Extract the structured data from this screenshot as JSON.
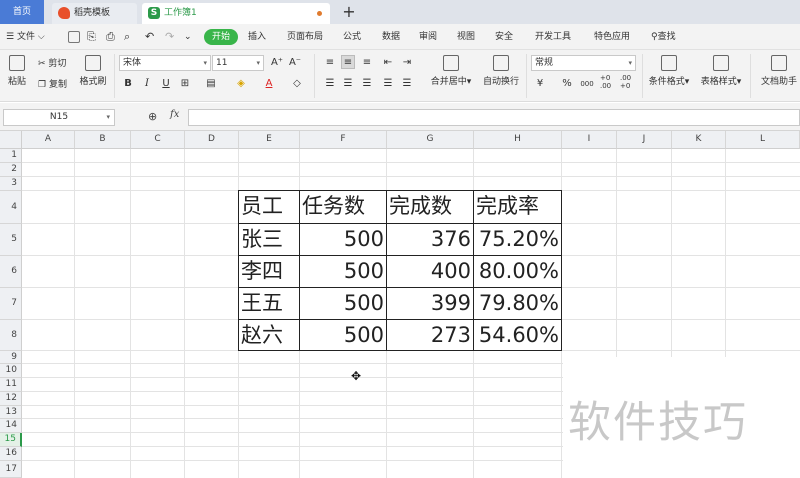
{
  "tabs": {
    "home": "首页",
    "daoke": "稻壳模板",
    "workbook": "工作簿1",
    "add": "+"
  },
  "menu": {
    "file": "文件",
    "items": [
      "开始",
      "插入",
      "页面布局",
      "公式",
      "数据",
      "审阅",
      "视图",
      "安全",
      "开发工具",
      "特色应用"
    ],
    "search": "查找"
  },
  "ribbon": {
    "paste": "粘贴",
    "cut": "剪切",
    "copy": "复制",
    "format_painter": "格式刷",
    "font_name": "宋体",
    "font_size": "11",
    "bold": "B",
    "italic": "I",
    "underline": "U",
    "merge_center": "合并居中",
    "wrap_text": "自动换行",
    "number_format": "常规",
    "percent": "%",
    "thousands": "000",
    "inc_decimal": "+0 .00",
    "dec_decimal": ".00 +0",
    "conditional_format": "条件格式",
    "table_style": "表格样式",
    "doc_helper": "文档助手"
  },
  "formula_bar": {
    "name_box": "N15",
    "fx": "fx",
    "formula": ""
  },
  "columns": [
    "A",
    "B",
    "C",
    "D",
    "E",
    "F",
    "G",
    "H",
    "I",
    "J",
    "K",
    "L"
  ],
  "rows": [
    "1",
    "2",
    "3",
    "4",
    "5",
    "6",
    "7",
    "8",
    "9",
    "10",
    "11",
    "12",
    "13",
    "14",
    "15",
    "16",
    "17"
  ],
  "selected_row": "15",
  "table": {
    "headers": [
      "员工",
      "任务数",
      "完成数",
      "完成率"
    ],
    "rows": [
      [
        "张三",
        "500",
        "376",
        "75.20%"
      ],
      [
        "李四",
        "500",
        "400",
        "80.00%"
      ],
      [
        "王五",
        "500",
        "399",
        "79.80%"
      ],
      [
        "赵六",
        "500",
        "273",
        "54.60%"
      ]
    ]
  },
  "watermark": "软件技巧"
}
